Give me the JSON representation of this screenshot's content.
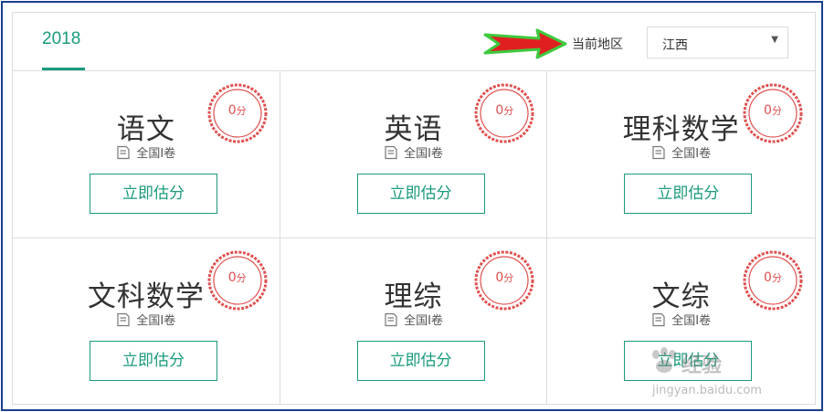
{
  "header": {
    "year_tab": "2018",
    "region_label": "当前地区",
    "region_value": "江西"
  },
  "colors": {
    "accent": "#1a9a7c",
    "stamp": "#e04f4f",
    "arrow": "#e02020",
    "arrow_outline": "#3fc93f",
    "frame": "#1b3f8f"
  },
  "cards": [
    {
      "subject": "语文",
      "paper": "全国I卷",
      "score": "0",
      "score_unit": "分",
      "button": "立即估分"
    },
    {
      "subject": "英语",
      "paper": "全国I卷",
      "score": "0",
      "score_unit": "分",
      "button": "立即估分"
    },
    {
      "subject": "理科数学",
      "paper": "全国I卷",
      "score": "0",
      "score_unit": "分",
      "button": "立即估分"
    },
    {
      "subject": "文科数学",
      "paper": "全国I卷",
      "score": "0",
      "score_unit": "分",
      "button": "立即估分"
    },
    {
      "subject": "理综",
      "paper": "全国I卷",
      "score": "0",
      "score_unit": "分",
      "button": "立即估分"
    },
    {
      "subject": "文综",
      "paper": "全国I卷",
      "score": "0",
      "score_unit": "分",
      "button": "立即估分"
    }
  ],
  "watermark": {
    "title": "经验",
    "url": "jingyan.baidu.com"
  }
}
